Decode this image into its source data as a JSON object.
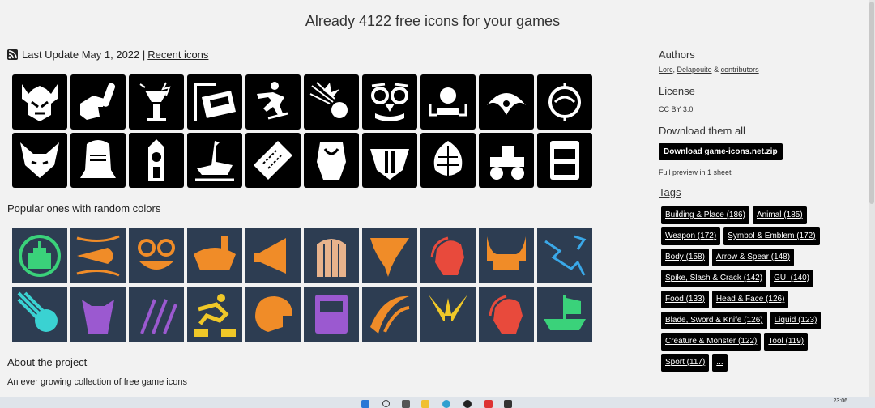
{
  "header": {
    "title": "Already 4122 free icons for your games"
  },
  "update": {
    "label": "Last Update May 1, 2022 |",
    "link": "Recent icons"
  },
  "latest_icons": [
    "viking-helmet-icon",
    "test-tube-hand-icon",
    "broken-lamp-icon",
    "train-icon",
    "skateboarder-icon",
    "meteor-impact-icon",
    "groucho-glasses-icon",
    "stage-light-icon",
    "cyclops-bird-icon",
    "satellite-globe-icon",
    "fox-head-icon",
    "knight-helmet-icon",
    "clock-tower-icon",
    "goose-icon",
    "ticket-icon",
    "owl-icon",
    "badger-icon",
    "artichoke-icon",
    "road-roller-icon",
    "slot-machine-icon"
  ],
  "popular": {
    "heading": "Popular ones with random colors",
    "icons": [
      {
        "name": "castle-emblem-icon",
        "color": "#3ad27a"
      },
      {
        "name": "speeding-bullet-icon",
        "color": "#f08c28"
      },
      {
        "name": "grinning-monster-icon",
        "color": "#f08c28"
      },
      {
        "name": "potion-bowl-icon",
        "color": "#f08c28"
      },
      {
        "name": "megaphone-icon",
        "color": "#f08c28"
      },
      {
        "name": "wooden-door-icon",
        "color": "#e8b38c"
      },
      {
        "name": "tornado-icon",
        "color": "#f08c28"
      },
      {
        "name": "laurel-head-icon",
        "color": "#e84a3c"
      },
      {
        "name": "horned-helmet-icon",
        "color": "#f08c28"
      },
      {
        "name": "lightning-arrows-icon",
        "color": "#3aa8e8"
      },
      {
        "name": "comet-icon",
        "color": "#3ad2d2"
      },
      {
        "name": "dwarf-face-icon",
        "color": "#9b59d0"
      },
      {
        "name": "wheat-icon",
        "color": "#9b59d0"
      },
      {
        "name": "jumping-man-icon",
        "color": "#f0c828"
      },
      {
        "name": "football-helmet-icon",
        "color": "#f08c28"
      },
      {
        "name": "spellbook-icon",
        "color": "#9b59d0"
      },
      {
        "name": "claw-slash-icon",
        "color": "#f08c28"
      },
      {
        "name": "light-pillar-icon",
        "color": "#f0c828"
      },
      {
        "name": "laurel-head-icon",
        "color": "#e84a3c"
      },
      {
        "name": "drakkar-ship-icon",
        "color": "#3ad27a"
      }
    ]
  },
  "about": {
    "heading": "About the project",
    "text": "An ever growing collection of free game icons"
  },
  "sidebar": {
    "authors_heading": "Authors",
    "author_1": "Lorc",
    "author_sep_1": ",",
    "author_2": "Delapouite",
    "author_sep_2": "&",
    "author_3": "contributors",
    "license_heading": "License",
    "license": "CC BY 3.0",
    "download_heading": "Download them all",
    "download_button": "Download game-icons.net.zip",
    "preview_link": "Full preview in 1 sheet",
    "tags_heading": "Tags",
    "tags": [
      "Building & Place (186)",
      "Animal (185)",
      "Weapon (172)",
      "Symbol & Emblem (172)",
      "Body (158)",
      "Arrow & Spear (148)",
      "Spike, Slash & Crack (142)",
      "GUI (140)",
      "Food (133)",
      "Head & Face (126)",
      "Blade, Sword & Knife (126)",
      "Liquid (123)",
      "Creature & Monster (122)",
      "Tool (119)",
      "Sport (117)",
      "..."
    ]
  },
  "taskbar": {
    "time": "23:06"
  }
}
